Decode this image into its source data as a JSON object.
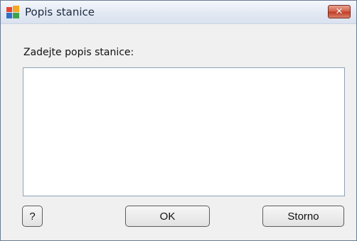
{
  "window": {
    "title": "Popis stanice",
    "close_glyph": "✕",
    "app_icon": "avg-logo-icon"
  },
  "form": {
    "prompt_label": "Zadejte popis stanice:",
    "description_value": ""
  },
  "buttons": {
    "help_label": "?",
    "ok_label": "OK",
    "cancel_label": "Storno"
  },
  "colors": {
    "close_button": "#c64a32",
    "dialog_background": "#f0f0f0"
  }
}
